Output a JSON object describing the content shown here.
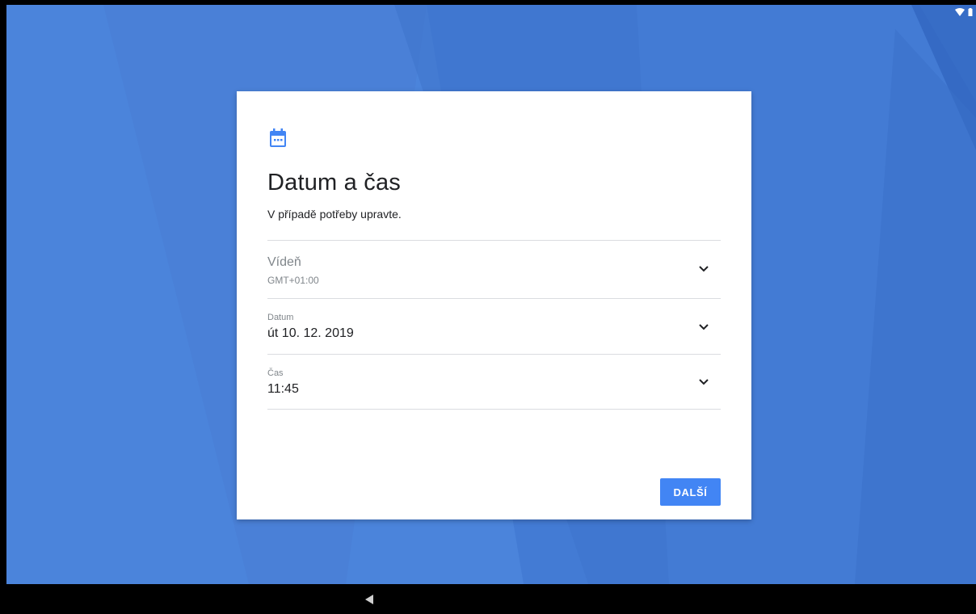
{
  "status_bar": {
    "icons": [
      "wifi-icon",
      "battery-icon"
    ]
  },
  "card": {
    "icon": "calendar-icon",
    "title": "Datum a čas",
    "subtitle": "V případě potřeby upravte.",
    "timezone": {
      "name": "Vídeň",
      "offset": "GMT+01:00"
    },
    "date": {
      "label": "Datum",
      "value": "út 10. 12. 2019"
    },
    "time": {
      "label": "Čas",
      "value": "11:45"
    },
    "next_label": "DALŠÍ"
  },
  "nav_bar": {
    "icons": [
      "back-icon"
    ]
  },
  "colors": {
    "accent": "#4285f4",
    "background": "#4a82d8"
  }
}
